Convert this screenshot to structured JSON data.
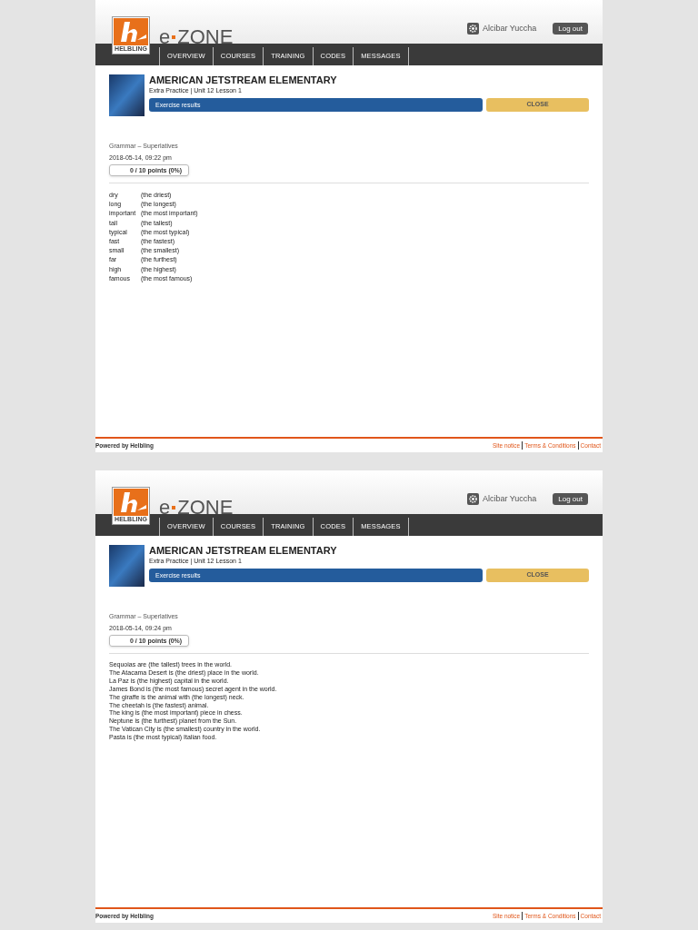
{
  "pages": [
    {
      "header": {
        "logo_label": "HELBLING",
        "brand_prefix": "e",
        "brand_name": "ZONE",
        "user": "Alcibar Yuccha",
        "logout": "Log out"
      },
      "nav": [
        "OVERVIEW",
        "COURSES",
        "TRAINING",
        "CODES",
        "MESSAGES"
      ],
      "course": {
        "title": "AMERICAN JETSTREAM ELEMENTARY",
        "subtitle": "Extra Practice | Unit 12 Lesson 1",
        "results": "Exercise results",
        "close": "CLOSE"
      },
      "exercise": {
        "name": "Grammar – Superlatives",
        "date": "2018-05-14, 09:22 pm",
        "score": "0 / 10 points (0%)"
      },
      "content": {
        "kind": "word_list",
        "rows": [
          {
            "word": "dry",
            "answer": "(the driest)"
          },
          {
            "word": "long",
            "answer": "(the longest)"
          },
          {
            "word": "important",
            "answer": "(the most important)"
          },
          {
            "word": "tall",
            "answer": "(the tallest)"
          },
          {
            "word": "typical",
            "answer": "(the most typical)"
          },
          {
            "word": "fast",
            "answer": "(the fastest)"
          },
          {
            "word": "small",
            "answer": "(the smallest)"
          },
          {
            "word": "far",
            "answer": "(the furthest)"
          },
          {
            "word": "high",
            "answer": "(the highest)"
          },
          {
            "word": "famous",
            "answer": "(the most famous)"
          }
        ]
      },
      "footer": {
        "powered": "Powered by Helbling",
        "links": [
          "Site notice",
          "Terms & Conditions",
          "Contact"
        ]
      }
    },
    {
      "header": {
        "logo_label": "HELBLING",
        "brand_prefix": "e",
        "brand_name": "ZONE",
        "user": "Alcibar Yuccha",
        "logout": "Log out"
      },
      "nav": [
        "OVERVIEW",
        "COURSES",
        "TRAINING",
        "CODES",
        "MESSAGES"
      ],
      "course": {
        "title": "AMERICAN JETSTREAM ELEMENTARY",
        "subtitle": "Extra Practice | Unit 12 Lesson 1",
        "results": "Exercise results",
        "close": "CLOSE"
      },
      "exercise": {
        "name": "Grammar – Superlatives",
        "date": "2018-05-14, 09:24 pm",
        "score": "0 / 10 points (0%)"
      },
      "content": {
        "kind": "sentences",
        "lines": [
          "Sequoias are (the tallest) trees in the world.",
          "The Atacama Desert is (the driest) place in the world.",
          "La Paz is (the highest) capital in the world.",
          "James Bond is (the most famous) secret agent in the world.",
          "The giraffe is the animal with (the longest) neck.",
          "The cheetah is (the fastest) animal.",
          "The king is (the most important) piece in chess.",
          "Neptune is (the furthest) planet from the Sun.",
          "The Vatican City is (the smallest) country in the world.",
          "Pasta is (the most typical) Italian food."
        ]
      },
      "footer": {
        "powered": "Powered by Helbling",
        "links": [
          "Site notice",
          "Terms & Conditions",
          "Contact"
        ]
      }
    }
  ]
}
